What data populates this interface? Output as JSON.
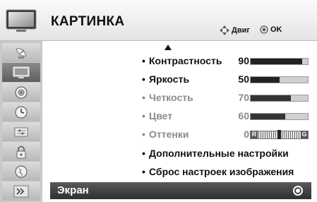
{
  "header": {
    "title": "КАРТИНКА",
    "hint_move": "Двиг",
    "hint_ok": "OK",
    "icon": "tv-icon"
  },
  "sidebar": {
    "items": [
      {
        "icon": "satellite-dish-icon",
        "active": false
      },
      {
        "icon": "tv-picture-icon",
        "active": true
      },
      {
        "icon": "speaker-audio-icon",
        "active": false
      },
      {
        "icon": "clock-icon",
        "active": false
      },
      {
        "icon": "options-icon",
        "active": false
      },
      {
        "icon": "lock-icon",
        "active": false
      },
      {
        "icon": "globe-icon",
        "active": false
      },
      {
        "icon": "input-icon",
        "active": false
      }
    ]
  },
  "settings": {
    "contrast": {
      "label": "Контрастность",
      "value": "90",
      "level": 0.9
    },
    "brightness": {
      "label": "Яркость",
      "value": "50",
      "level": 0.5
    },
    "sharpness": {
      "label": "Четкость",
      "value": "70",
      "level": 0.7
    },
    "color": {
      "label": "Цвет",
      "value": "60",
      "level": 0.6
    },
    "tint": {
      "label": "Оттенки",
      "value": "0",
      "left": "R",
      "right": "G"
    },
    "advanced": {
      "label": "Дополнительные настройки"
    },
    "reset": {
      "label": "Сброс настроек изображения"
    }
  },
  "selected": {
    "label": "Экран"
  },
  "colors": {
    "accent": "#3f3f3f",
    "sidebar": "#c9c9c9",
    "dim_text": "#8a8a8a"
  }
}
